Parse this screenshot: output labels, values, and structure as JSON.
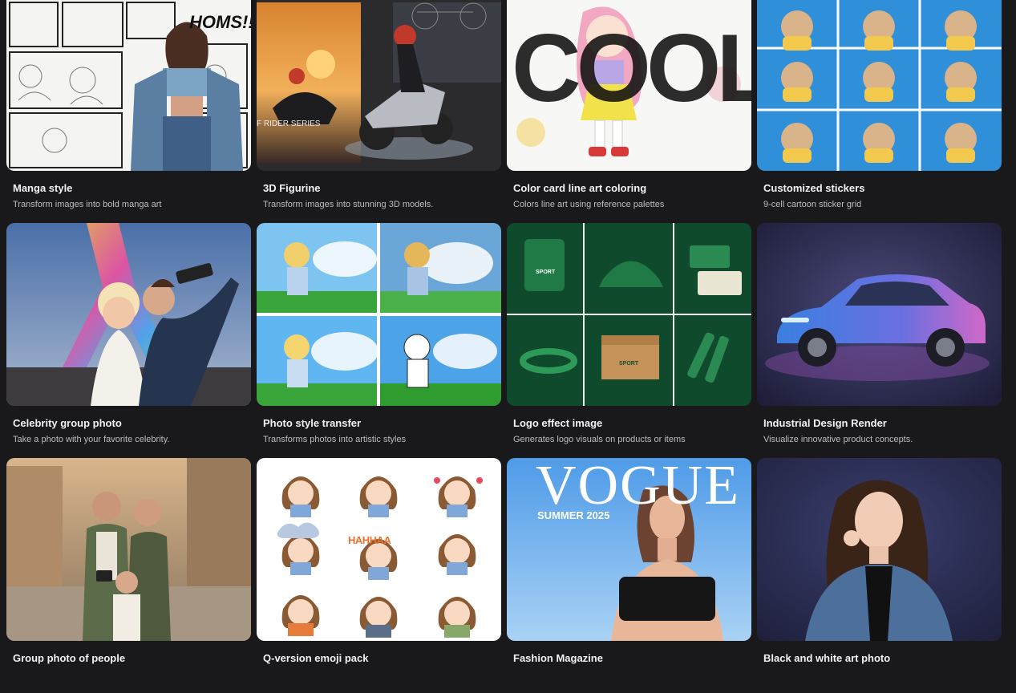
{
  "cards": [
    {
      "title": "Manga style",
      "desc": "Transform images into bold manga art",
      "image_text": "HOMS!!"
    },
    {
      "title": "3D Figurine",
      "desc": "Transform images into stunning 3D models.",
      "image_text": "F RIDER SERIES"
    },
    {
      "title": "Color card line art coloring",
      "desc": "Colors line art using reference palettes",
      "image_text": "COOL"
    },
    {
      "title": "Customized stickers",
      "desc": "9-cell cartoon sticker grid"
    },
    {
      "title": "Celebrity group photo",
      "desc": "Take a photo with your favorite celebrity."
    },
    {
      "title": "Photo style transfer",
      "desc": "Transforms photos into artistic styles"
    },
    {
      "title": "Logo effect image",
      "desc": "Generates logo visuals on products or items",
      "image_text": "SPORT"
    },
    {
      "title": "Industrial Design Render",
      "desc": "Visualize innovative product concepts."
    },
    {
      "title": "Group photo of people",
      "desc": ""
    },
    {
      "title": "Q-version emoji pack",
      "desc": "",
      "image_text": "HAHHAA"
    },
    {
      "title": "Fashion Magazine",
      "desc": "",
      "image_text": "VOGUE",
      "image_subtext": "SUMMER 2025"
    },
    {
      "title": "Black and white art photo",
      "desc": ""
    }
  ]
}
